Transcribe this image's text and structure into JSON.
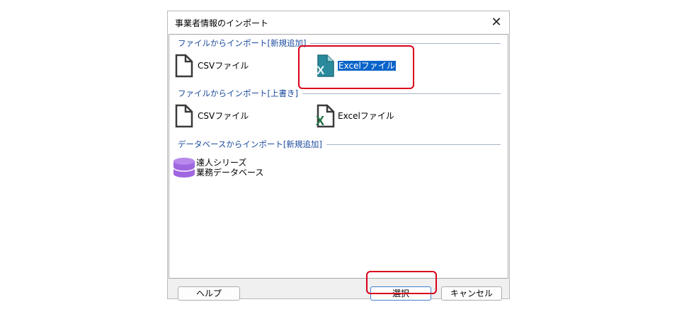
{
  "dialog": {
    "title": "事業者情報のインポート",
    "close_glyph": "✕"
  },
  "sections": {
    "new_file": {
      "label": "ファイルからインポート[新規追加]",
      "csv_label": "CSVファイル",
      "excel_label": "Excelファイル"
    },
    "overwrite_file": {
      "label": "ファイルからインポート[上書き]",
      "csv_label": "CSVファイル",
      "excel_label": "Excelファイル"
    },
    "database": {
      "label": "データベースからインポート[新規追加]",
      "item_line1": "達人シリーズ",
      "item_line2": "業務データベース"
    }
  },
  "footer": {
    "help_label": "ヘルプ",
    "select_label": "選択",
    "cancel_label": "キャンセル"
  },
  "colors": {
    "section_text": "#1a4a9c",
    "selection": "#0a64c9",
    "highlight": "#d9001b",
    "excel_green": "#1d7044",
    "db_purple": "#a066e0"
  },
  "icons": {
    "file": "file-icon",
    "excel": "excel-icon",
    "database": "database-icon",
    "close": "close-icon"
  }
}
